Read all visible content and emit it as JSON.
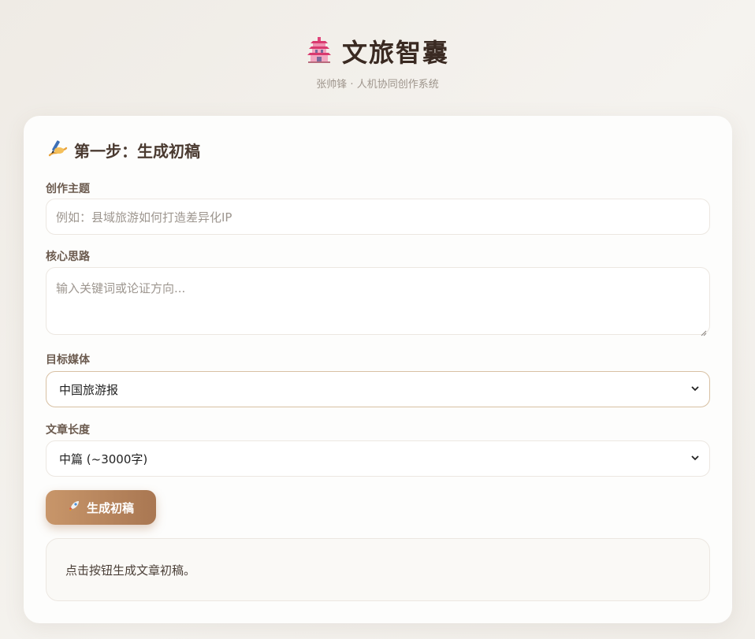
{
  "header": {
    "icon": "pagoda-icon",
    "title": "文旅智囊",
    "subtitle": "张帅锋 · 人机协同创作系统"
  },
  "step1": {
    "icon": "writing-hand-icon",
    "title": "第一步：生成初稿",
    "topic": {
      "label": "创作主题",
      "placeholder": "例如：县域旅游如何打造差异化IP",
      "value": ""
    },
    "idea": {
      "label": "核心思路",
      "placeholder": "输入关键词或论证方向...",
      "value": ""
    },
    "media": {
      "label": "目标媒体",
      "selected": "中国旅游报"
    },
    "length": {
      "label": "文章长度",
      "selected": "中篇 (~3000字)"
    },
    "generate_button": {
      "icon": "rocket-icon",
      "label": "生成初稿"
    },
    "output_text": "点击按钮生成文章初稿。"
  },
  "colors": {
    "accent_start": "#c8966a",
    "accent_end": "#a97752",
    "title": "#3a2a22"
  }
}
